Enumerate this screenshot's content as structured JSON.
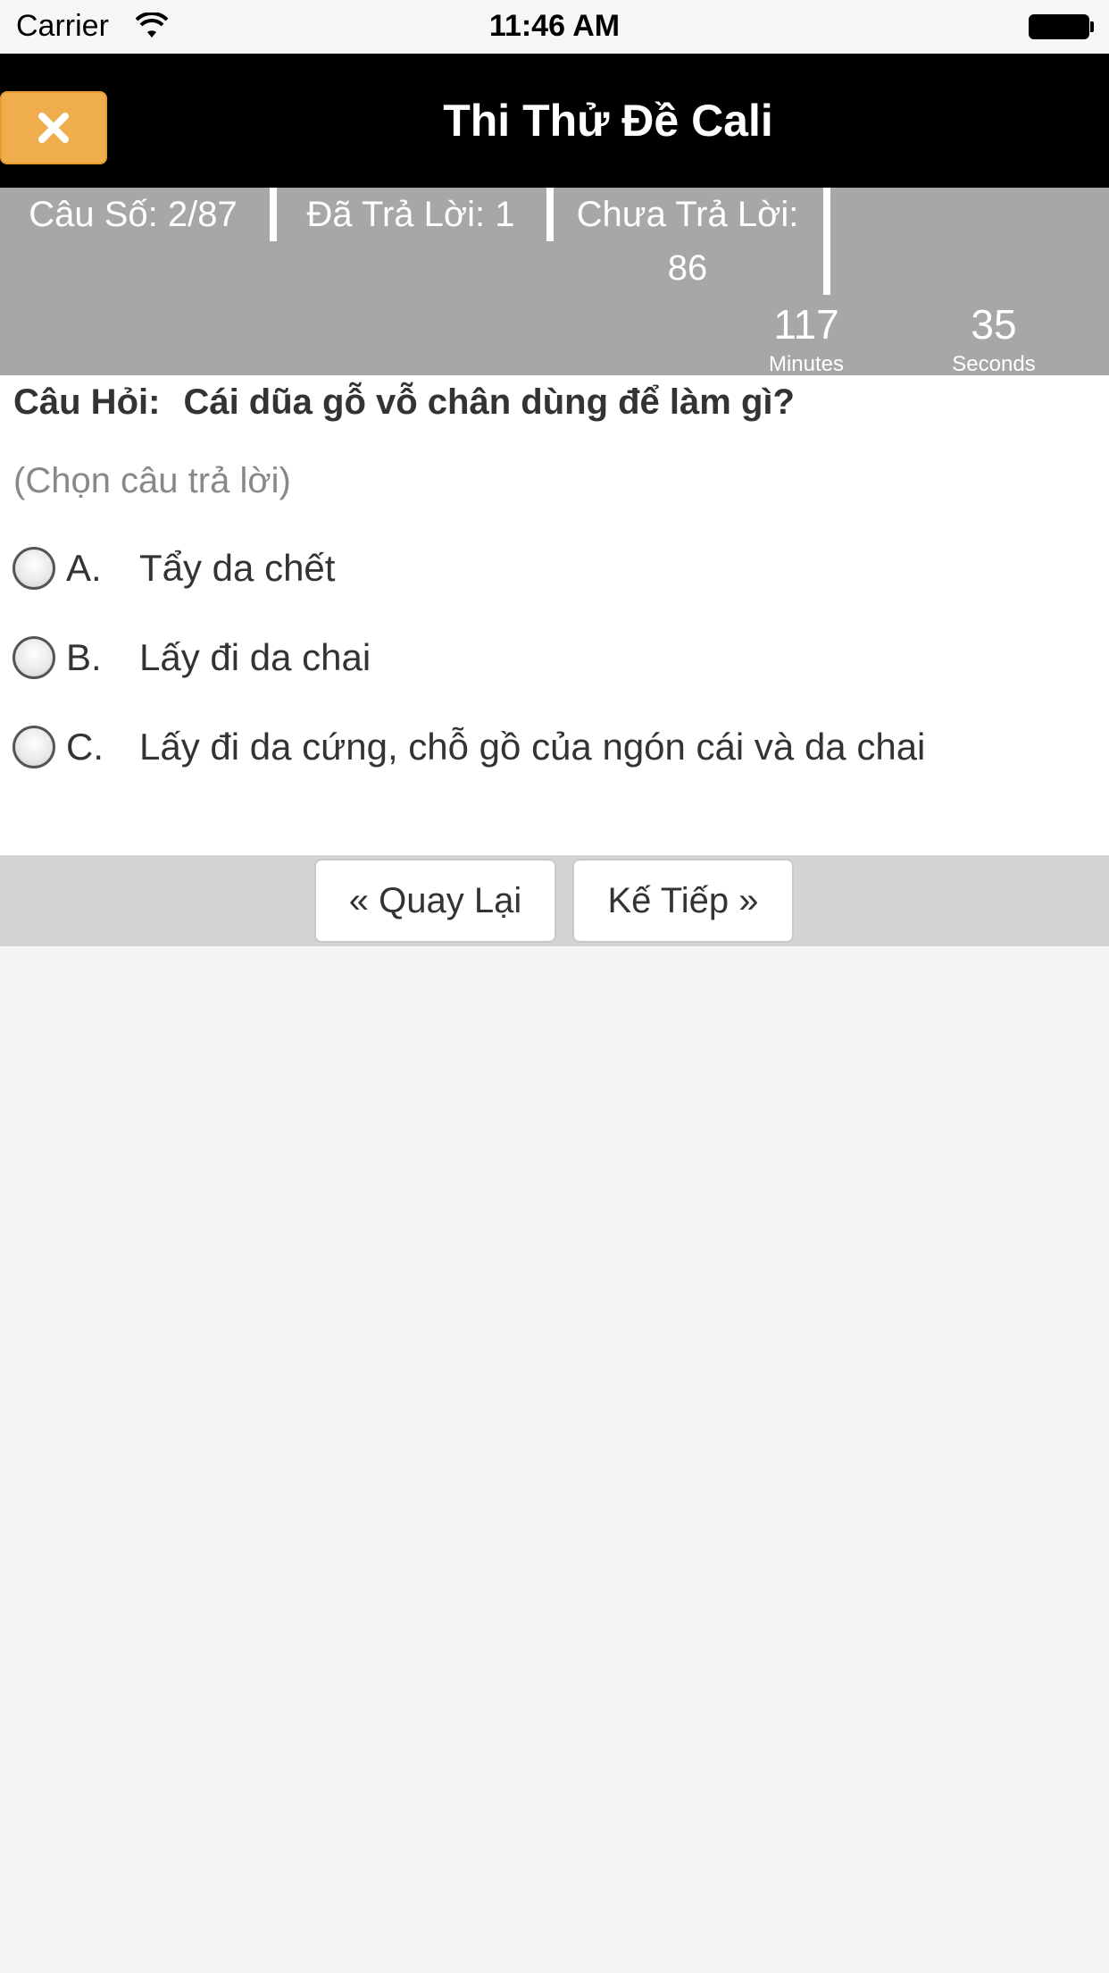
{
  "status_bar": {
    "carrier": "Carrier",
    "time": "11:46 AM"
  },
  "nav": {
    "title": "Thi Thử Đề Cali",
    "close_icon": "close-icon",
    "close_color": "#f0ad4e"
  },
  "stats": {
    "question_number": "Câu Số: 2/87",
    "answered": "Đã Trả Lời: 1",
    "unanswered_label": "Chưa Trả Lời:",
    "unanswered_value": "86"
  },
  "timer": {
    "minutes": "117",
    "minutes_label": "Minutes",
    "seconds": "35",
    "seconds_label": "Seconds"
  },
  "question": {
    "label": "Câu Hỏi:",
    "text": "Cái dũa gỗ vỗ chân dùng để làm gì?",
    "hint": "(Chọn câu trả lời)",
    "options": [
      {
        "letter": "A.",
        "text": "Tẩy da chết",
        "selected": false
      },
      {
        "letter": "B.",
        "text": "Lấy đi da chai",
        "selected": false
      },
      {
        "letter": "C.",
        "text": "Lấy đi da cứng, chỗ gồ của ngón cái và da chai",
        "selected": false
      }
    ]
  },
  "buttons": {
    "prev": "« Quay Lại",
    "next": "Kế Tiếp »"
  }
}
